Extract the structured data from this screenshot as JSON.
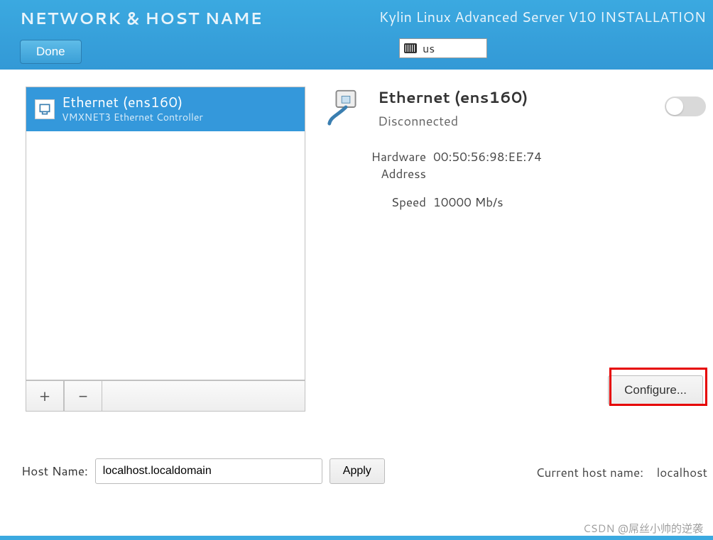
{
  "header": {
    "title": "NETWORK & HOST NAME",
    "done_label": "Done",
    "installer_title": "Kylin Linux Advanced Server V10 INSTALLATION",
    "keyboard_layout": "us"
  },
  "network_list": {
    "items": [
      {
        "label": "Ethernet (ens160)",
        "controller": "VMXNET3 Ethernet Controller",
        "selected": true
      }
    ],
    "add_label": "+",
    "remove_label": "−"
  },
  "detail": {
    "title": "Ethernet (ens160)",
    "status": "Disconnected",
    "hw_label": "Hardware Address",
    "hw_value": "00:50:56:98:EE:74",
    "speed_label": "Speed",
    "speed_value": "10000 Mb/s",
    "toggle_on": false,
    "configure_label": "Configure..."
  },
  "hostname": {
    "label": "Host Name:",
    "value": "localhost.localdomain",
    "apply_label": "Apply",
    "current_label": "Current host name:",
    "current_value": "localhost"
  },
  "watermark": "CSDN @屌丝小帅的逆袭"
}
